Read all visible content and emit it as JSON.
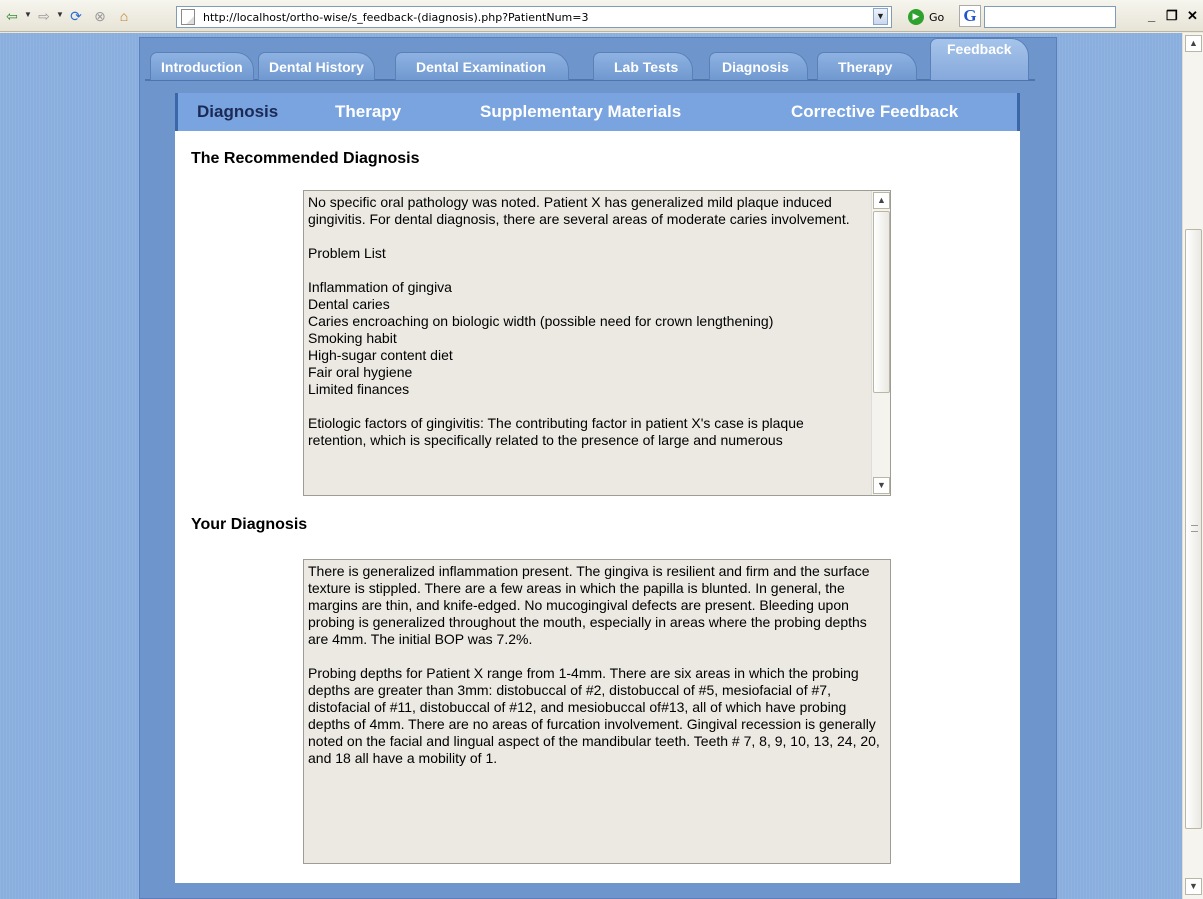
{
  "browser": {
    "url": "http://localhost/ortho-wise/s_feedback-(diagnosis).php?PatientNum=3",
    "go_label": "Go"
  },
  "main_tabs": [
    "Introduction",
    "Dental History",
    "Dental Examination",
    "Lab Tests",
    "Diagnosis",
    "Therapy",
    "Feedback"
  ],
  "active_main_tab": "Feedback",
  "sub_nav": {
    "diagnosis": "Diagnosis",
    "therapy": "Therapy",
    "supplementary": "Supplementary Materials",
    "corrective": "Corrective Feedback"
  },
  "recommended": {
    "title": "The Recommended Diagnosis",
    "summary": "No specific oral pathology was noted.  Patient X has generalized mild plaque induced gingivitis.  For dental diagnosis, there are several areas of moderate caries involvement.",
    "problem_list_heading": "Problem List",
    "problems": [
      "Inflammation of gingiva",
      "Dental caries",
      "Caries encroaching on biologic width (possible need for crown lengthening)",
      "Smoking habit",
      "High-sugar content diet",
      "Fair oral hygiene",
      "Limited finances"
    ],
    "etiology": "Etiologic factors of gingivitis: The contributing factor in patient X's case is plaque retention, which is specifically related to the presence of large and numerous"
  },
  "yours": {
    "title": "Your Diagnosis",
    "para1": "There is generalized inflammation present.  The gingiva is resilient and firm and the surface texture is stippled.  There are a few areas in which the papilla is blunted.  In general, the margins are thin, and knife-edged.  No mucogingival defects are present.  Bleeding upon probing is generalized throughout the mouth, especially in areas where the probing depths are 4mm.  The initial BOP was 7.2%.",
    "para2": "Probing depths for Patient X range from 1-4mm.  There are six areas in which the probing depths are greater than 3mm:  distobuccal of #2, distobuccal of #5, mesiofacial of #7, distofacial of #11, distobuccal of #12, and mesiobuccal of#13, all of which have probing depths of 4mm.  There are no areas of furcation involvement.  Gingival recession is generally noted on the facial and lingual aspect of the mandibular teeth.  Teeth # 7, 8, 9, 10, 13, 24, 20, and 18 all have a mobility of 1."
  }
}
